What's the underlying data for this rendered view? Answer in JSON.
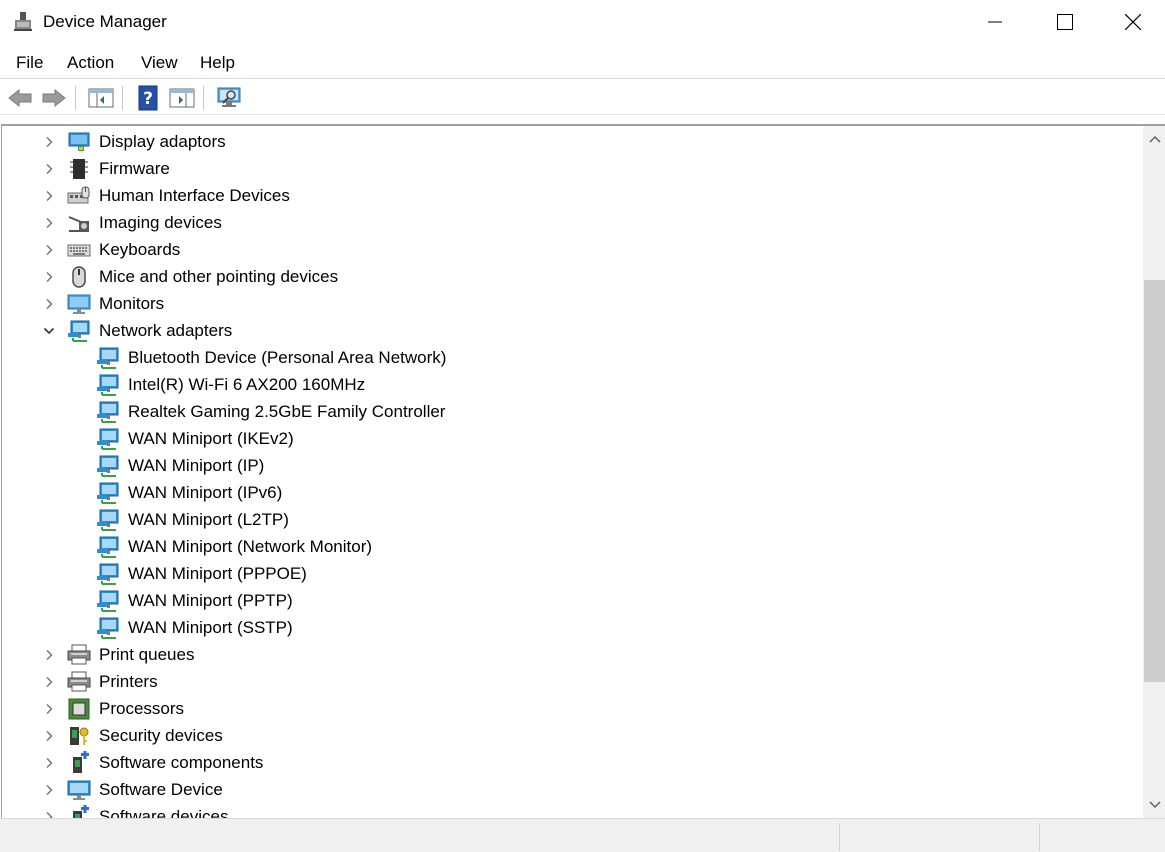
{
  "window": {
    "title": "Device Manager",
    "icon": "device-manager-icon"
  },
  "menu": {
    "file": "File",
    "action": "Action",
    "view": "View",
    "help": "Help"
  },
  "toolbar": {
    "items": [
      "back-arrow-icon",
      "forward-arrow-icon",
      "show-hide-console-tree-icon",
      "help-icon",
      "show-hide-action-pane-icon",
      "scan-hardware-icon"
    ]
  },
  "tree": {
    "items": [
      {
        "label": "Display adaptors",
        "icon": "display-adapter-icon",
        "expanded": false,
        "level": 0
      },
      {
        "label": "Firmware",
        "icon": "firmware-icon",
        "expanded": false,
        "level": 0
      },
      {
        "label": "Human Interface Devices",
        "icon": "hid-icon",
        "expanded": false,
        "level": 0
      },
      {
        "label": "Imaging devices",
        "icon": "camera-icon",
        "expanded": false,
        "level": 0
      },
      {
        "label": "Keyboards",
        "icon": "keyboard-icon",
        "expanded": false,
        "level": 0
      },
      {
        "label": "Mice and other pointing devices",
        "icon": "mouse-icon",
        "expanded": false,
        "level": 0
      },
      {
        "label": "Monitors",
        "icon": "monitor-icon",
        "expanded": false,
        "level": 0
      },
      {
        "label": "Network adapters",
        "icon": "network-adapter-icon",
        "expanded": true,
        "level": 0
      },
      {
        "label": "Bluetooth Device (Personal Area Network)",
        "icon": "network-adapter-icon",
        "level": 1
      },
      {
        "label": "Intel(R) Wi-Fi 6 AX200 160MHz",
        "icon": "network-adapter-icon",
        "level": 1
      },
      {
        "label": "Realtek Gaming 2.5GbE Family Controller",
        "icon": "network-adapter-icon",
        "level": 1
      },
      {
        "label": "WAN Miniport (IKEv2)",
        "icon": "network-adapter-icon",
        "level": 1
      },
      {
        "label": "WAN Miniport (IP)",
        "icon": "network-adapter-icon",
        "level": 1
      },
      {
        "label": "WAN Miniport (IPv6)",
        "icon": "network-adapter-icon",
        "level": 1
      },
      {
        "label": "WAN Miniport (L2TP)",
        "icon": "network-adapter-icon",
        "level": 1
      },
      {
        "label": "WAN Miniport (Network Monitor)",
        "icon": "network-adapter-icon",
        "level": 1
      },
      {
        "label": "WAN Miniport (PPPOE)",
        "icon": "network-adapter-icon",
        "level": 1
      },
      {
        "label": "WAN Miniport (PPTP)",
        "icon": "network-adapter-icon",
        "level": 1
      },
      {
        "label": "WAN Miniport (SSTP)",
        "icon": "network-adapter-icon",
        "level": 1
      },
      {
        "label": "Print queues",
        "icon": "printer-icon",
        "expanded": false,
        "level": 0
      },
      {
        "label": "Printers",
        "icon": "printer-icon",
        "expanded": false,
        "level": 0
      },
      {
        "label": "Processors",
        "icon": "processor-icon",
        "expanded": false,
        "level": 0
      },
      {
        "label": "Security devices",
        "icon": "security-device-icon",
        "expanded": false,
        "level": 0
      },
      {
        "label": "Software components",
        "icon": "software-component-icon",
        "expanded": false,
        "level": 0
      },
      {
        "label": "Software Device",
        "icon": "software-device-icon",
        "expanded": false,
        "level": 0
      },
      {
        "label": "Software devices",
        "icon": "software-component-icon",
        "expanded": false,
        "level": 0
      }
    ]
  },
  "colors": {
    "network_blue": "#2b8fd6",
    "cable_green": "#3aa14a",
    "scroll_thumb": "#cdcdcd"
  }
}
